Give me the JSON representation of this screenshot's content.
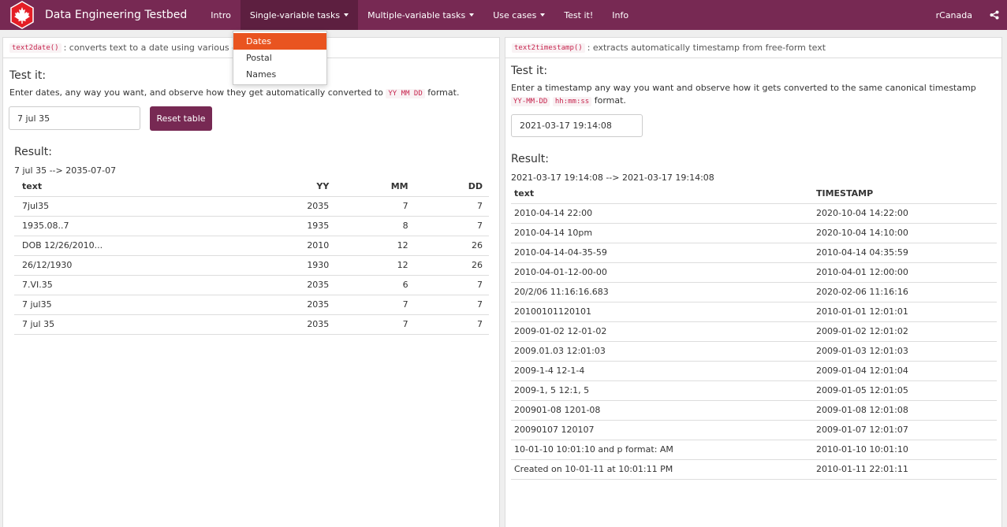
{
  "navbar": {
    "brand": "Data Engineering Testbed",
    "items": [
      {
        "label": "Intro",
        "caret": false,
        "active": false
      },
      {
        "label": "Single-variable tasks",
        "caret": true,
        "active": true
      },
      {
        "label": "Multiple-variable tasks",
        "caret": true,
        "active": false
      },
      {
        "label": "Use cases",
        "caret": true,
        "active": false
      },
      {
        "label": "Test it!",
        "caret": false,
        "active": false
      },
      {
        "label": "Info",
        "caret": false,
        "active": false
      }
    ],
    "right_link": "rCanada"
  },
  "dropdown": {
    "items": [
      "Dates",
      "Postal",
      "Names"
    ],
    "selected": "Dates"
  },
  "left": {
    "code": "text2date()",
    "heading": ": converts text to a date using various decis",
    "test_title": "Test it:",
    "desc_pre": "Enter dates, any way you want, and observe how they get automatically converted to",
    "desc_code": "YY MM DD",
    "desc_post": "format.",
    "input_value": "7 jul 35",
    "reset_label": "Reset table",
    "result_title": "Result:",
    "result_line": "7 jul 35 --> 2035-07-07",
    "table": {
      "headers": [
        "text",
        "YY",
        "MM",
        "DD"
      ],
      "rows": [
        [
          "7jul35",
          "2035",
          "7",
          "7"
        ],
        [
          "1935.08..7",
          "1935",
          "8",
          "7"
        ],
        [
          "DOB 12/26/2010...",
          "2010",
          "12",
          "26"
        ],
        [
          "26/12/1930",
          "1930",
          "12",
          "26"
        ],
        [
          "7.VI.35",
          "2035",
          "6",
          "7"
        ],
        [
          "7 jul35",
          "2035",
          "7",
          "7"
        ],
        [
          "7 jul 35",
          "2035",
          "7",
          "7"
        ]
      ]
    }
  },
  "right": {
    "code": "text2timestamp()",
    "heading": ": extracts automatically timestamp from free-form text",
    "test_title": "Test it:",
    "desc_pre": "Enter a timestamp any way you want and observe how it gets converted to the same canonical timestamp",
    "desc_code1": "YY-MM-DD",
    "desc_code2": "hh:mm:ss",
    "desc_post": "format.",
    "input_value": "2021-03-17 19:14:08",
    "result_title": "Result:",
    "result_line": "2021-03-17 19:14:08 --> 2021-03-17 19:14:08",
    "table": {
      "headers": [
        "text",
        "TIMESTAMP"
      ],
      "rows": [
        [
          "2010-04-14 22:00",
          "2020-10-04 14:22:00"
        ],
        [
          "2010-04-14 10pm",
          "2020-10-04 14:10:00"
        ],
        [
          "2010-04-14-04-35-59",
          "2010-04-14 04:35:59"
        ],
        [
          "2010-04-01-12-00-00",
          "2010-04-01 12:00:00"
        ],
        [
          "20/2/06 11:16:16.683",
          "2020-02-06 11:16:16"
        ],
        [
          "20100101120101",
          "2010-01-01 12:01:01"
        ],
        [
          "2009-01-02 12-01-02",
          "2009-01-02 12:01:02"
        ],
        [
          "2009.01.03 12:01:03",
          "2009-01-03 12:01:03"
        ],
        [
          "2009-1-4 12-1-4",
          "2009-01-04 12:01:04"
        ],
        [
          "2009-1, 5 12:1, 5",
          "2009-01-05 12:01:05"
        ],
        [
          "200901-08 1201-08",
          "2009-01-08 12:01:08"
        ],
        [
          "20090107 120107",
          "2009-01-07 12:01:07"
        ],
        [
          "10-01-10 10:01:10 and p format: AM",
          "2010-01-10 10:01:10"
        ],
        [
          "Created on 10-01-11 at 10:01:11 PM",
          "2010-01-11 22:01:11"
        ]
      ]
    }
  },
  "colors": {
    "navbar": "#772953",
    "navbar_active": "#5d1f40",
    "dropdown_active": "#e95420",
    "button": "#772953",
    "logo_red": "#e41e26"
  },
  "icons": {
    "logo": "maple-leaf-icon",
    "share": "share-icon",
    "caret": "caret-down-icon"
  }
}
